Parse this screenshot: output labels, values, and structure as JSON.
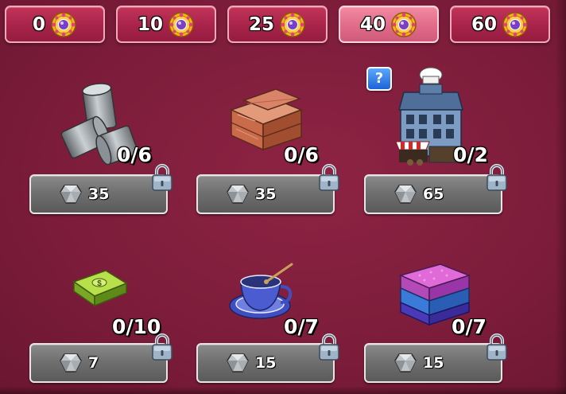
{
  "tiers": [
    {
      "value": "0",
      "active": false
    },
    {
      "value": "10",
      "active": false
    },
    {
      "value": "25",
      "active": false
    },
    {
      "value": "40",
      "active": true
    },
    {
      "value": "60",
      "active": false
    }
  ],
  "help": {
    "label": "?"
  },
  "items": [
    {
      "name": "metal-pipes",
      "count": "0/6",
      "price": "35",
      "locked": true
    },
    {
      "name": "wood-planks",
      "count": "0/6",
      "price": "35",
      "locked": true
    },
    {
      "name": "restaurant-building",
      "count": "0/2",
      "price": "65",
      "locked": true
    },
    {
      "name": "cash-stack",
      "count": "0/10",
      "price": "7",
      "locked": true
    },
    {
      "name": "teacup",
      "count": "0/7",
      "price": "15",
      "locked": true
    },
    {
      "name": "fabric-stack",
      "count": "0/7",
      "price": "15",
      "locked": true
    }
  ],
  "colors": {
    "background": "#7d1d3b",
    "tab": "#a8234a",
    "tab_active": "#e16b89",
    "pricebar": "#707070"
  }
}
